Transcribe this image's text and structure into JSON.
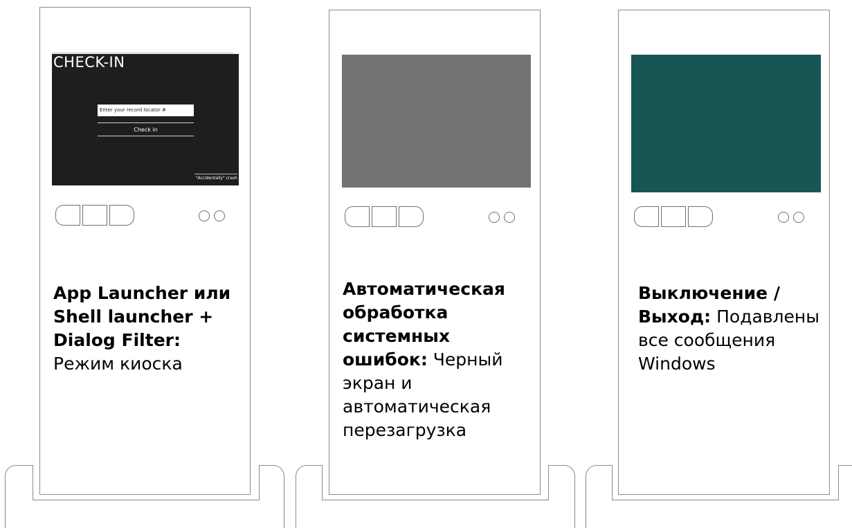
{
  "kiosks": [
    {
      "screen_color": "#1e1e1e",
      "screen": {
        "title": "CHECK-IN",
        "input_placeholder": "Enter your record locator #",
        "button_label": "Check in",
        "crash_link": "\"Accidentally\" crash"
      },
      "desc_bold": "App Launcher или Shell launcher + Dialog Filter:",
      "desc_text": " Режим киоска"
    },
    {
      "screen_color": "#737373",
      "desc_bold": "Автоматическая обработка системных ошибок:",
      "desc_text": " Черный экран и автоматическая перезагрузка"
    },
    {
      "screen_color": "#175654",
      "desc_bold": "Выключение / Выход:",
      "desc_text": " Подавлены все сообщения Windows"
    }
  ]
}
